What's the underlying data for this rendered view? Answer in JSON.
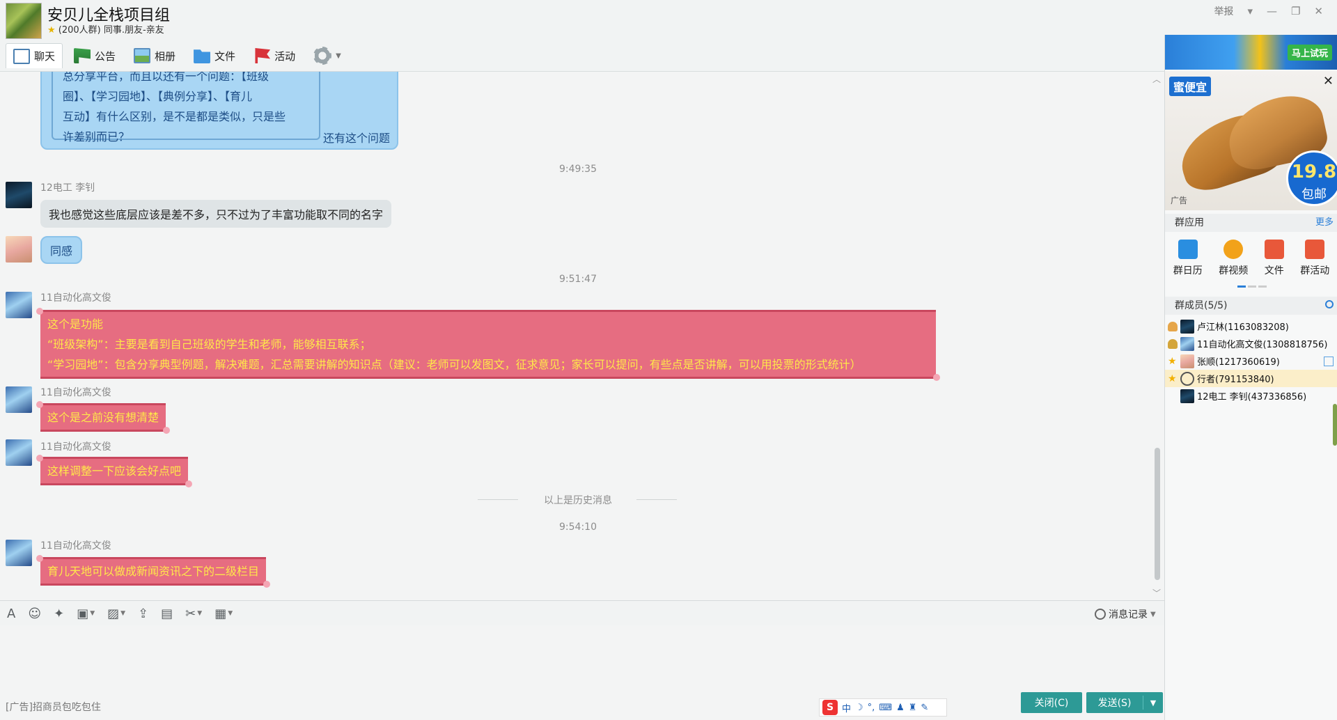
{
  "window": {
    "group_name": "安贝儿全栈项目组",
    "group_sub": "(200人群) 同事.朋友-亲友",
    "report": "举报"
  },
  "tabs": [
    {
      "label": "聊天",
      "icon": "chat-icon"
    },
    {
      "label": "公告",
      "icon": "notice-icon"
    },
    {
      "label": "相册",
      "icon": "album-icon"
    },
    {
      "label": "文件",
      "icon": "folder-icon"
    },
    {
      "label": "活动",
      "icon": "activity-flag-icon"
    }
  ],
  "chat": {
    "quote": {
      "lines": [
        "总分享平台，而且以还有一个问题：【班级",
        "圈】、【学习园地】、【典例分享】、【育儿",
        "互动】有什么区别，是不是都是类似，只是些",
        "许差别而已？"
      ],
      "reply": "还有这个问题"
    },
    "ts1": "9:49:35",
    "msg1": {
      "name": "12电工 李钊",
      "text": "我也感觉这些底层应该是差不多，只不过为了丰富功能取不同的名字"
    },
    "msg2": {
      "text": "同感"
    },
    "ts2": "9:51:47",
    "msg3": {
      "name": "11自动化高文俊",
      "lines": [
        "这个是功能",
        "“班级架构”：主要是看到自己班级的学生和老师，能够相互联系；",
        "“学习园地”：包含分享典型例题，解决难题，汇总需要讲解的知识点（建议：老师可以发图文，征求意见；家长可以提问，有些点是否讲解，可以用投票的形式统计）"
      ]
    },
    "msg4": {
      "name": "11自动化高文俊",
      "text": "这个是之前没有想清楚"
    },
    "msg5": {
      "name": "11自动化高文俊",
      "text": "这样调整一下应该会好点吧"
    },
    "history_divider": "以上是历史消息",
    "ts3": "9:54:10",
    "msg6": {
      "name": "11自动化高文俊",
      "text": "育儿天地可以做成新闻资讯之下的二级栏目"
    }
  },
  "input": {
    "history_label": "消息记录",
    "ad_text": "[广告]招商员包吃包住",
    "ime_cn": "中",
    "close_label": "关闭(C)",
    "send_label": "发送(S)"
  },
  "right_panel": {
    "ad_top_button": "马上试玩",
    "ad_brand": "蜜便宜",
    "ad_price": "19.8",
    "ad_price_sub": "包邮",
    "ad_label": "广告",
    "apps_title": "群应用",
    "apps_more": "更多",
    "apps": [
      {
        "label": "群日历",
        "icon": "calendar-icon",
        "color": "#2a8ee0"
      },
      {
        "label": "群视频",
        "icon": "video-icon",
        "color": "#f2a21a"
      },
      {
        "label": "文件",
        "icon": "folder-icon",
        "color": "#e8583a"
      },
      {
        "label": "群活动",
        "icon": "trophy-icon",
        "color": "#e8583a"
      }
    ],
    "members_title": "群成员(5/5)",
    "members": [
      {
        "name": "卢江林(1163083208)",
        "role": "owner"
      },
      {
        "name": "11自动化高文俊(1308818756)",
        "role": "admin"
      },
      {
        "name": "张顺(1217360619)",
        "role": "star"
      },
      {
        "name": "行者(791153840)",
        "role": "star"
      },
      {
        "name": "12电工 李钊(437336856)",
        "role": "none"
      }
    ]
  },
  "colors": {
    "accent": "#2d9a96",
    "pink_bubble": "#e66d81",
    "pink_text": "#ffe84a",
    "blue_bubble": "#a9d6f4"
  }
}
